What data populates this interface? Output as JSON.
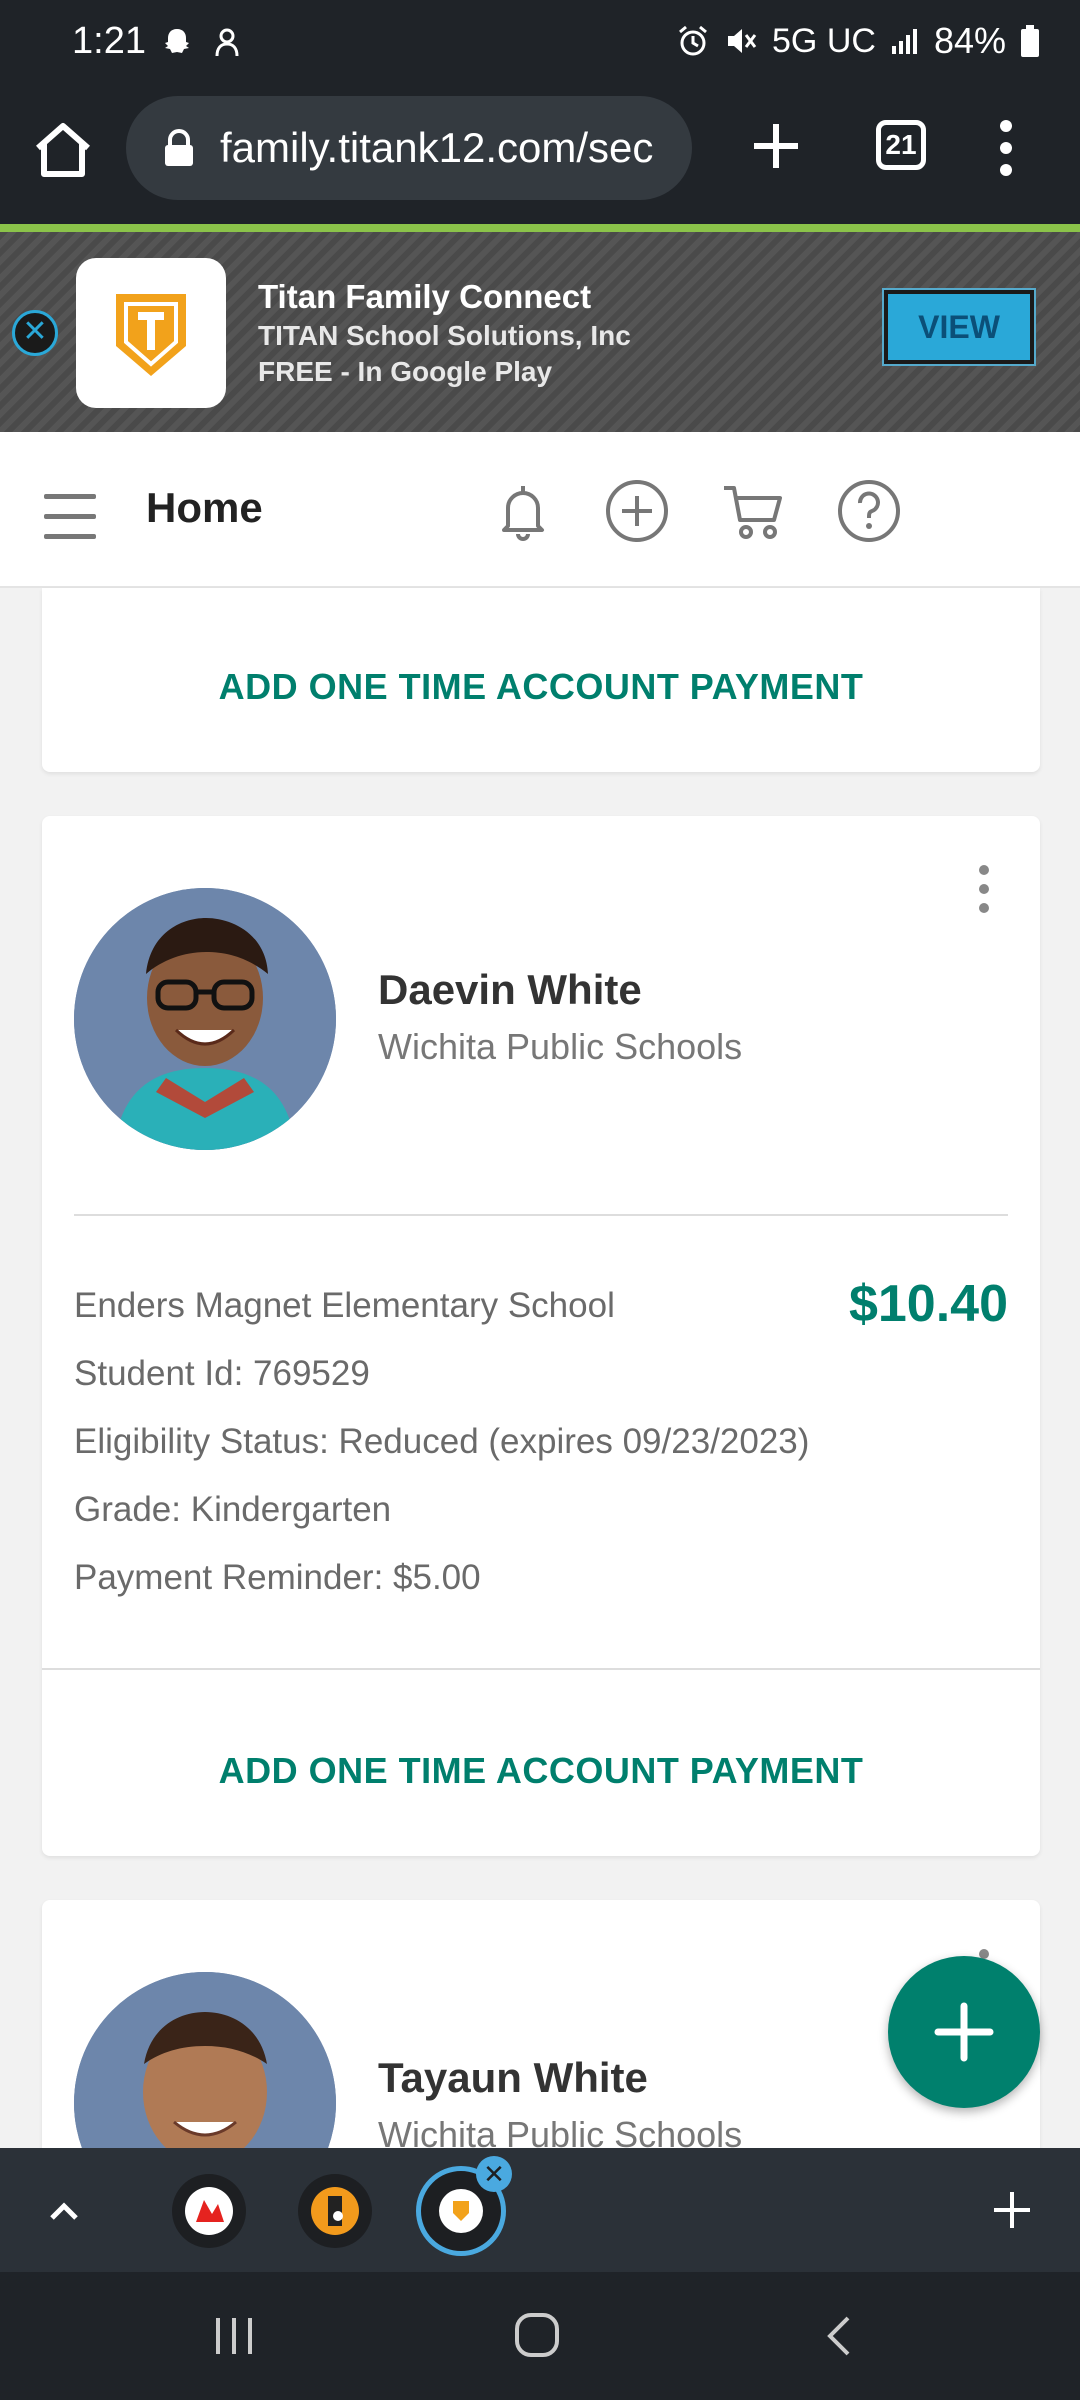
{
  "status_bar": {
    "time": "1:21",
    "network": "5G UC",
    "battery": "84%"
  },
  "browser": {
    "url": "family.titank12.com/sec",
    "tab_count": "21"
  },
  "banner": {
    "app_name": "Titan Family Connect",
    "publisher": "TITAN School Solutions, Inc",
    "price_store": "FREE - In Google Play",
    "view_label": "VIEW"
  },
  "header": {
    "title": "Home"
  },
  "cards": [
    {
      "action_label": "ADD ONE TIME ACCOUNT PAYMENT"
    },
    {
      "name": "Daevin White",
      "district": "Wichita Public Schools",
      "school": "Enders Magnet Elementary School",
      "balance": "$10.40",
      "student_id": "Student Id: 769529",
      "eligibility": "Eligibility Status: Reduced (expires 09/23/2023)",
      "grade": "Grade: Kindergarten",
      "payment_reminder": "Payment Reminder: $5.00",
      "action_label": "ADD ONE TIME ACCOUNT PAYMENT"
    },
    {
      "name": "Tayaun White",
      "district": "Wichita Public Schools"
    }
  ],
  "colors": {
    "accent": "#007f6d",
    "banner_button": "#2aa8d8",
    "browser_bar": "#1f2328"
  },
  "icons": [
    "home-icon",
    "lock-icon",
    "bell-icon",
    "add-circle-icon",
    "cart-icon",
    "help-icon",
    "kebab-icon",
    "plus-icon"
  ]
}
